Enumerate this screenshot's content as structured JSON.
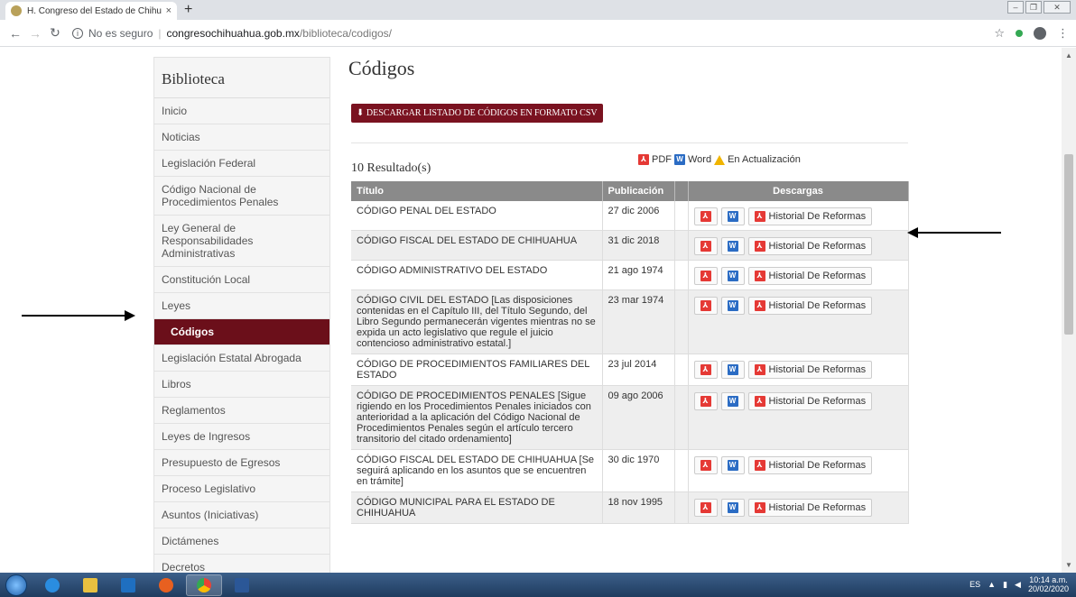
{
  "browser": {
    "tab_title": "H. Congreso del Estado de Chihu",
    "tab_close": "×",
    "new_tab": "+",
    "security_label": "No es seguro",
    "url_domain": "congresochihuahua.gob.mx",
    "url_path": "/biblioteca/codigos/"
  },
  "sidebar": {
    "title": "Biblioteca",
    "items": [
      {
        "label": "Inicio"
      },
      {
        "label": "Noticias"
      },
      {
        "label": "Legislación Federal"
      },
      {
        "label": "Código Nacional de Procedimientos Penales"
      },
      {
        "label": "Ley General de Responsabilidades Administrativas"
      },
      {
        "label": "Constitución Local"
      },
      {
        "label": "Leyes"
      },
      {
        "label": "Códigos"
      },
      {
        "label": "Legislación Estatal Abrogada"
      },
      {
        "label": "Libros"
      },
      {
        "label": "Reglamentos"
      },
      {
        "label": "Leyes de Ingresos"
      },
      {
        "label": "Presupuesto de Egresos"
      },
      {
        "label": "Proceso Legislativo"
      },
      {
        "label": "Asuntos (Iniciativas)"
      },
      {
        "label": "Dictámenes"
      },
      {
        "label": "Decretos"
      }
    ]
  },
  "main": {
    "title": "Códigos",
    "csv_button": "DESCARGAR LISTADO DE CÓDIGOS EN FORMATO CSV",
    "results": "10 Resultado(s)",
    "legend": {
      "pdf": "PDF",
      "word": "Word",
      "updating": "En Actualización"
    },
    "columns": {
      "title": "Título",
      "publication": "Publicación",
      "downloads": "Descargas"
    },
    "history_label": "Historial De Reformas",
    "rows": [
      {
        "title": "CÓDIGO PENAL DEL ESTADO",
        "date": "27 dic 2006"
      },
      {
        "title": "CÓDIGO FISCAL DEL ESTADO DE CHIHUAHUA",
        "date": "31 dic 2018"
      },
      {
        "title": "CÓDIGO ADMINISTRATIVO DEL ESTADO",
        "date": "21 ago 1974"
      },
      {
        "title": "CÓDIGO CIVIL DEL ESTADO [Las disposiciones contenidas en el Capítulo III, del Título Segundo, del Libro Segundo permanecerán vigentes mientras no se expida un acto legislativo que regule el juicio contencioso administrativo estatal.]",
        "date": "23 mar 1974"
      },
      {
        "title": "CÓDIGO DE PROCEDIMIENTOS FAMILIARES DEL ESTADO",
        "date": "23 jul 2014"
      },
      {
        "title": "CÓDIGO DE PROCEDIMIENTOS PENALES [Sigue rigiendo en los Procedimientos Penales iniciados con anterioridad a la aplicación del Código Nacional de Procedimientos Penales según el artículo tercero transitorio del citado ordenamiento]",
        "date": "09 ago 2006"
      },
      {
        "title": "CÓDIGO FISCAL DEL ESTADO DE CHIHUAHUA [Se seguirá aplicando en los asuntos que se encuentren en trámite]",
        "date": "30 dic 1970"
      },
      {
        "title": "CÓDIGO MUNICIPAL PARA EL ESTADO DE CHIHUAHUA",
        "date": "18 nov 1995"
      }
    ]
  },
  "taskbar": {
    "lang": "ES",
    "time": "10:14 a.m.",
    "date": "20/02/2020"
  },
  "colors": {
    "accent": "#6b0f1a",
    "pdf": "#e53935",
    "word": "#2b6cc4",
    "warning": "#f0b400"
  }
}
